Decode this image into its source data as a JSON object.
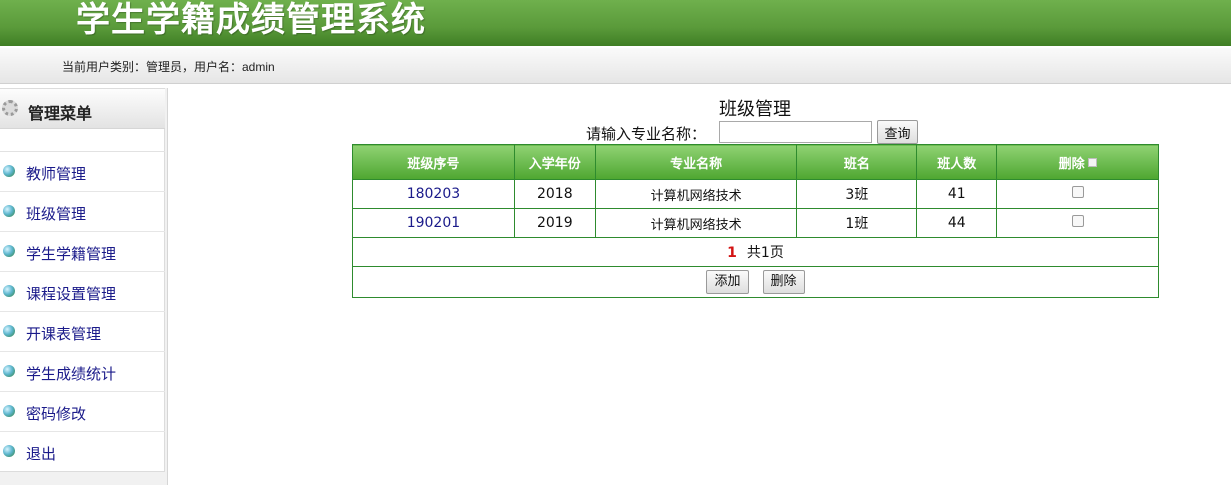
{
  "header": {
    "title": "学生学籍成绩管理系统"
  },
  "userbar": {
    "text": "当前用户类别：管理员，用户名：admin"
  },
  "sidebar": {
    "title": "管理菜单",
    "items": [
      {
        "label": "教师管理"
      },
      {
        "label": "班级管理"
      },
      {
        "label": "学生学籍管理"
      },
      {
        "label": "课程设置管理"
      },
      {
        "label": "开课表管理"
      },
      {
        "label": "学生成绩统计"
      },
      {
        "label": "密码修改"
      },
      {
        "label": "退出"
      }
    ]
  },
  "main": {
    "title": "班级管理",
    "search": {
      "label": "请输入专业名称：",
      "value": "",
      "button": "查询"
    },
    "table": {
      "columns": [
        "班级序号",
        "入学年份",
        "专业名称",
        "班名",
        "班人数",
        "删除"
      ],
      "rows": [
        {
          "id": "180203",
          "year": "2018",
          "major": "计算机网络技术",
          "class": "3班",
          "count": "41"
        },
        {
          "id": "190201",
          "year": "2019",
          "major": "计算机网络技术",
          "class": "1班",
          "count": "44"
        }
      ]
    },
    "pager": {
      "current": "1",
      "total": "共1页"
    },
    "actions": {
      "add": "添加",
      "delete": "删除"
    }
  }
}
